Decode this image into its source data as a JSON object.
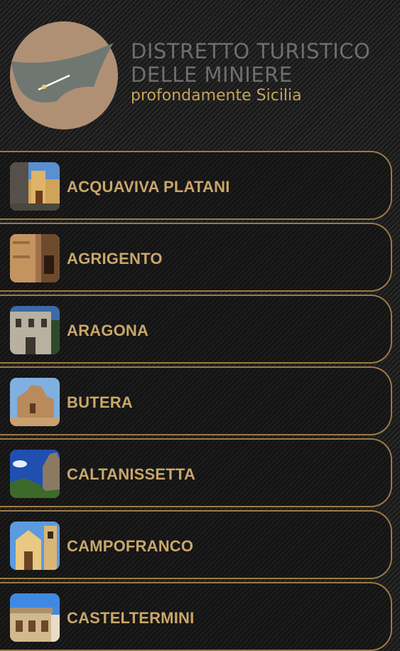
{
  "app": {
    "title_line1": "DISTRETTO TURISTICO",
    "title_line2": "DELLE MINIERE",
    "subtitle": "profondamente Sicilia",
    "colors": {
      "accent": "#c7a35a",
      "border": "#9a7a46",
      "title": "#6e6e6e"
    }
  },
  "towns": [
    {
      "label": "ACQUAVIVA PLATANI",
      "icon": "church-photo"
    },
    {
      "label": "AGRIGENTO",
      "icon": "old-street-photo"
    },
    {
      "label": "ARAGONA",
      "icon": "palace-photo"
    },
    {
      "label": "BUTERA",
      "icon": "castle-ruins-photo"
    },
    {
      "label": "CALTANISSETTA",
      "icon": "rocky-hill-photo"
    },
    {
      "label": "CAMPOFRANCO",
      "icon": "church-bell-tower-photo"
    },
    {
      "label": "CASTELTERMINI",
      "icon": "building-photo"
    }
  ]
}
